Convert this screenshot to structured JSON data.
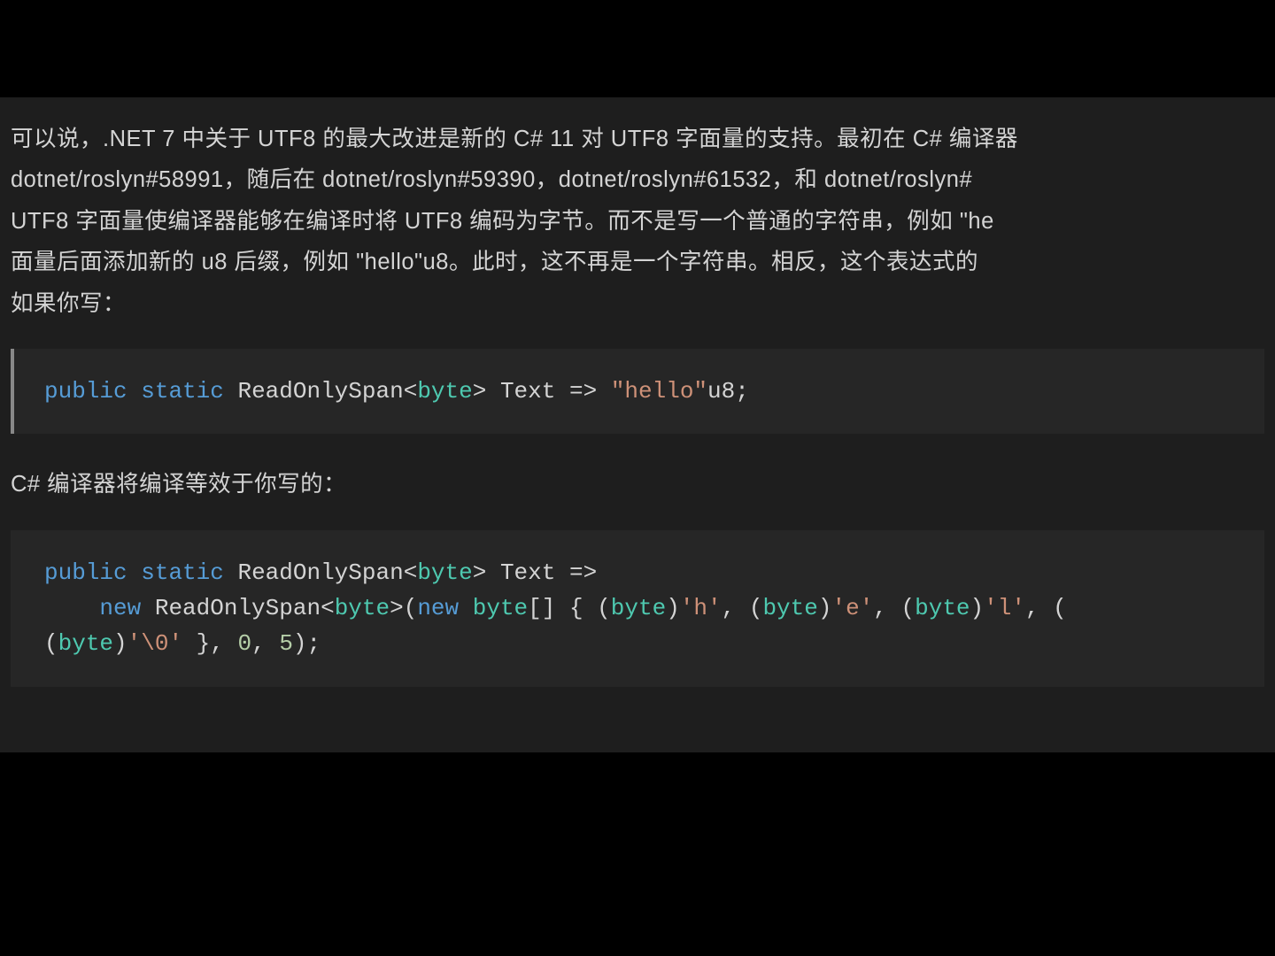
{
  "paragraph": {
    "line1": "可以说，.NET 7 中关于 UTF8 的最大改进是新的 C# 11 对 UTF8 字面量的支持。最初在 C# 编译器",
    "line2": "dotnet/roslyn#58991，随后在 dotnet/roslyn#59390，dotnet/roslyn#61532，和 dotnet/roslyn#",
    "line3": "UTF8 字面量使编译器能够在编译时将 UTF8 编码为字节。而不是写一个普通的字符串，例如 \"he",
    "line4": "面量后面添加新的 u8 后缀，例如 \"hello\"u8。此时，这不再是一个字符串。相反，这个表达式的",
    "line5": "如果你写："
  },
  "code1": {
    "kw_public": "public",
    "kw_static": "static",
    "type_span": "ReadOnlySpan",
    "type_byte": "byte",
    "ident_text": "Text",
    "arrow": "=>",
    "str_hello": "\"hello\"",
    "suffix": "u8",
    "semi": ";"
  },
  "para2": "C# 编译器将编译等效于你写的：",
  "code2": {
    "kw_public": "public",
    "kw_static": "static",
    "type_span": "ReadOnlySpan",
    "type_byte": "byte",
    "ident_text": "Text",
    "arrow": "=>",
    "kw_new": "new",
    "open_arr": "[] { (",
    "cast_byte": "byte",
    "close_cast": ")",
    "ch_h": "'h'",
    "ch_e": "'e'",
    "ch_l": "'l'",
    "ch_nul": "'\\0'",
    "tail_open": " }, ",
    "num0": "0",
    "comma": ", ",
    "num5": "5",
    "tail_close": ");"
  }
}
